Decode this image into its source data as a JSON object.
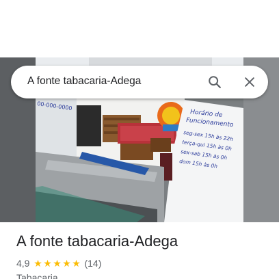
{
  "search": {
    "query": "A fonte tabacaria-Adega",
    "search_icon": "search-icon",
    "close_icon": "close-icon"
  },
  "place": {
    "name": "A fonte tabacaria-Adega",
    "rating": "4,9",
    "rating_stars": 5,
    "review_count": "(14)",
    "category": "Tabacaria"
  },
  "photo": {
    "sign_text": "Horário de Funcionamento",
    "hours_lines": [
      "seg-sex 15h às 22h",
      "terça-qui 15h às 0h",
      "sex-sab 15h às 0h",
      "dom 15h às 0h"
    ]
  },
  "colors": {
    "star": "#fbbc04",
    "text_primary": "#202124",
    "text_secondary": "#5f6368"
  }
}
